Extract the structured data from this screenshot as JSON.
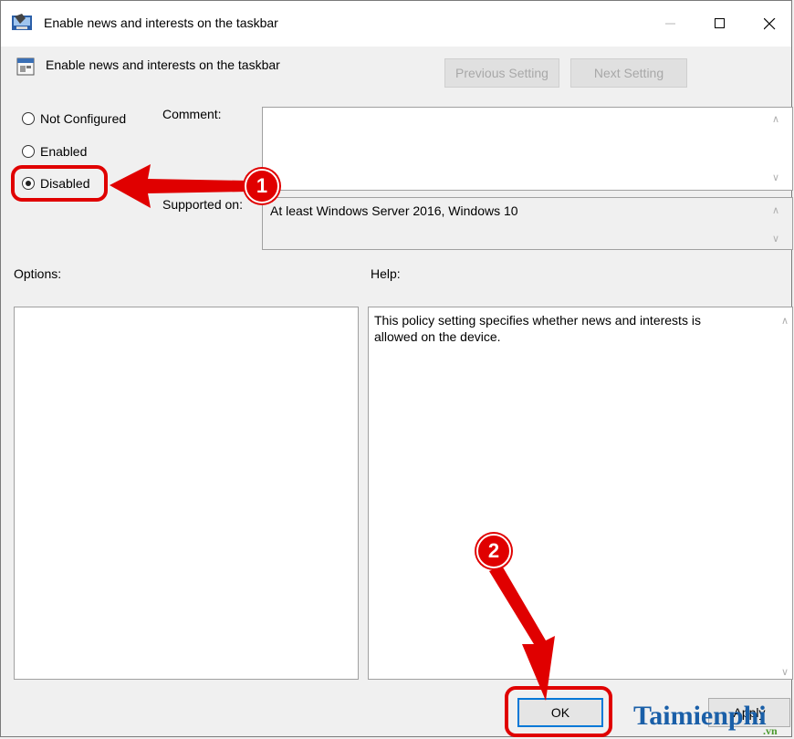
{
  "window": {
    "title": "Enable news and interests on the taskbar",
    "minimize_icon": "minimize-icon",
    "maximize_icon": "maximize-icon",
    "close_icon": "close-icon"
  },
  "header": {
    "policy_name": "Enable news and interests on the taskbar",
    "previous_label": "Previous Setting",
    "next_label": "Next Setting"
  },
  "state": {
    "options": [
      {
        "label": "Not Configured",
        "selected": false
      },
      {
        "label": "Enabled",
        "selected": false
      },
      {
        "label": "Disabled",
        "selected": true
      }
    ]
  },
  "comment": {
    "label": "Comment:",
    "value": ""
  },
  "supported": {
    "label": "Supported on:",
    "value": "At least Windows Server 2016, Windows 10"
  },
  "options_panel": {
    "label": "Options:"
  },
  "help_panel": {
    "label": "Help:",
    "text": "This policy setting specifies whether news and interests is allowed on the device."
  },
  "footer": {
    "ok_label": "OK",
    "apply_label": "Apply"
  },
  "annotations": {
    "step1": "1",
    "step2": "2",
    "color": "#e00000"
  },
  "watermark": {
    "text": "Taimienphi",
    "suffix": ".vn"
  }
}
